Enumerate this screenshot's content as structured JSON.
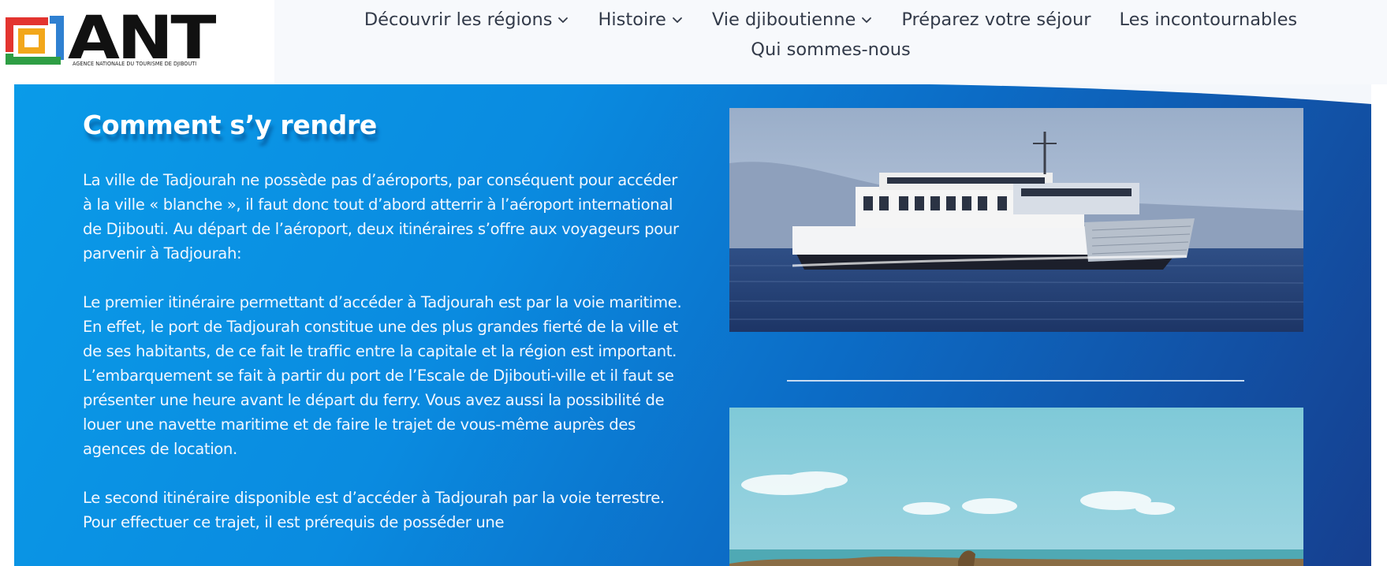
{
  "logo": {
    "brand": "ANT",
    "subtitle": "AGENCE NATIONALE DU TOURISME DE DJIBOUTI"
  },
  "nav": {
    "row1": [
      {
        "label": "Découvrir les régions",
        "dropdown": true
      },
      {
        "label": "Histoire",
        "dropdown": true
      },
      {
        "label": "Vie djiboutienne",
        "dropdown": true
      },
      {
        "label": "Préparez votre séjour",
        "dropdown": false
      },
      {
        "label": "Les incontournables",
        "dropdown": false
      }
    ],
    "row2": [
      {
        "label": "Qui sommes-nous",
        "dropdown": false
      }
    ]
  },
  "main": {
    "title": "Comment s’y rendre",
    "paragraphs": [
      "La ville de Tadjourah ne possède pas d’aéroports, par conséquent pour accéder à la ville « blanche », il faut donc tout d’abord atterrir à l’aéroport international de Djibouti. Au départ de l’aéroport, deux itinéraires s’offre aux voyageurs pour parvenir à Tadjourah:",
      "Le premier itinéraire permettant d’accéder à Tadjourah est par la voie maritime. En effet, le port de Tadjourah constitue une des plus grandes fierté de la ville et de ses habitants, de ce fait le traffic entre la capitale et la région est important. L’embarquement se fait à partir du port de l’Escale de Djibouti-ville et il faut se présenter une heure avant le départ du ferry. Vous avez aussi la possibilité de louer une navette maritime et de faire le trajet de vous-même auprès des agences de location.",
      "Le second itinéraire disponible est d’accéder à Tadjourah par la voie terrestre. Pour effectuer ce trajet, il est prérequis de posséder une"
    ]
  },
  "colors": {
    "header_bg": "#f7f9fc",
    "nav_text": "#333b4a",
    "section_blue_light": "#0a9be8",
    "section_blue_dark": "#163f8f",
    "text_light": "#f1f7ff"
  }
}
